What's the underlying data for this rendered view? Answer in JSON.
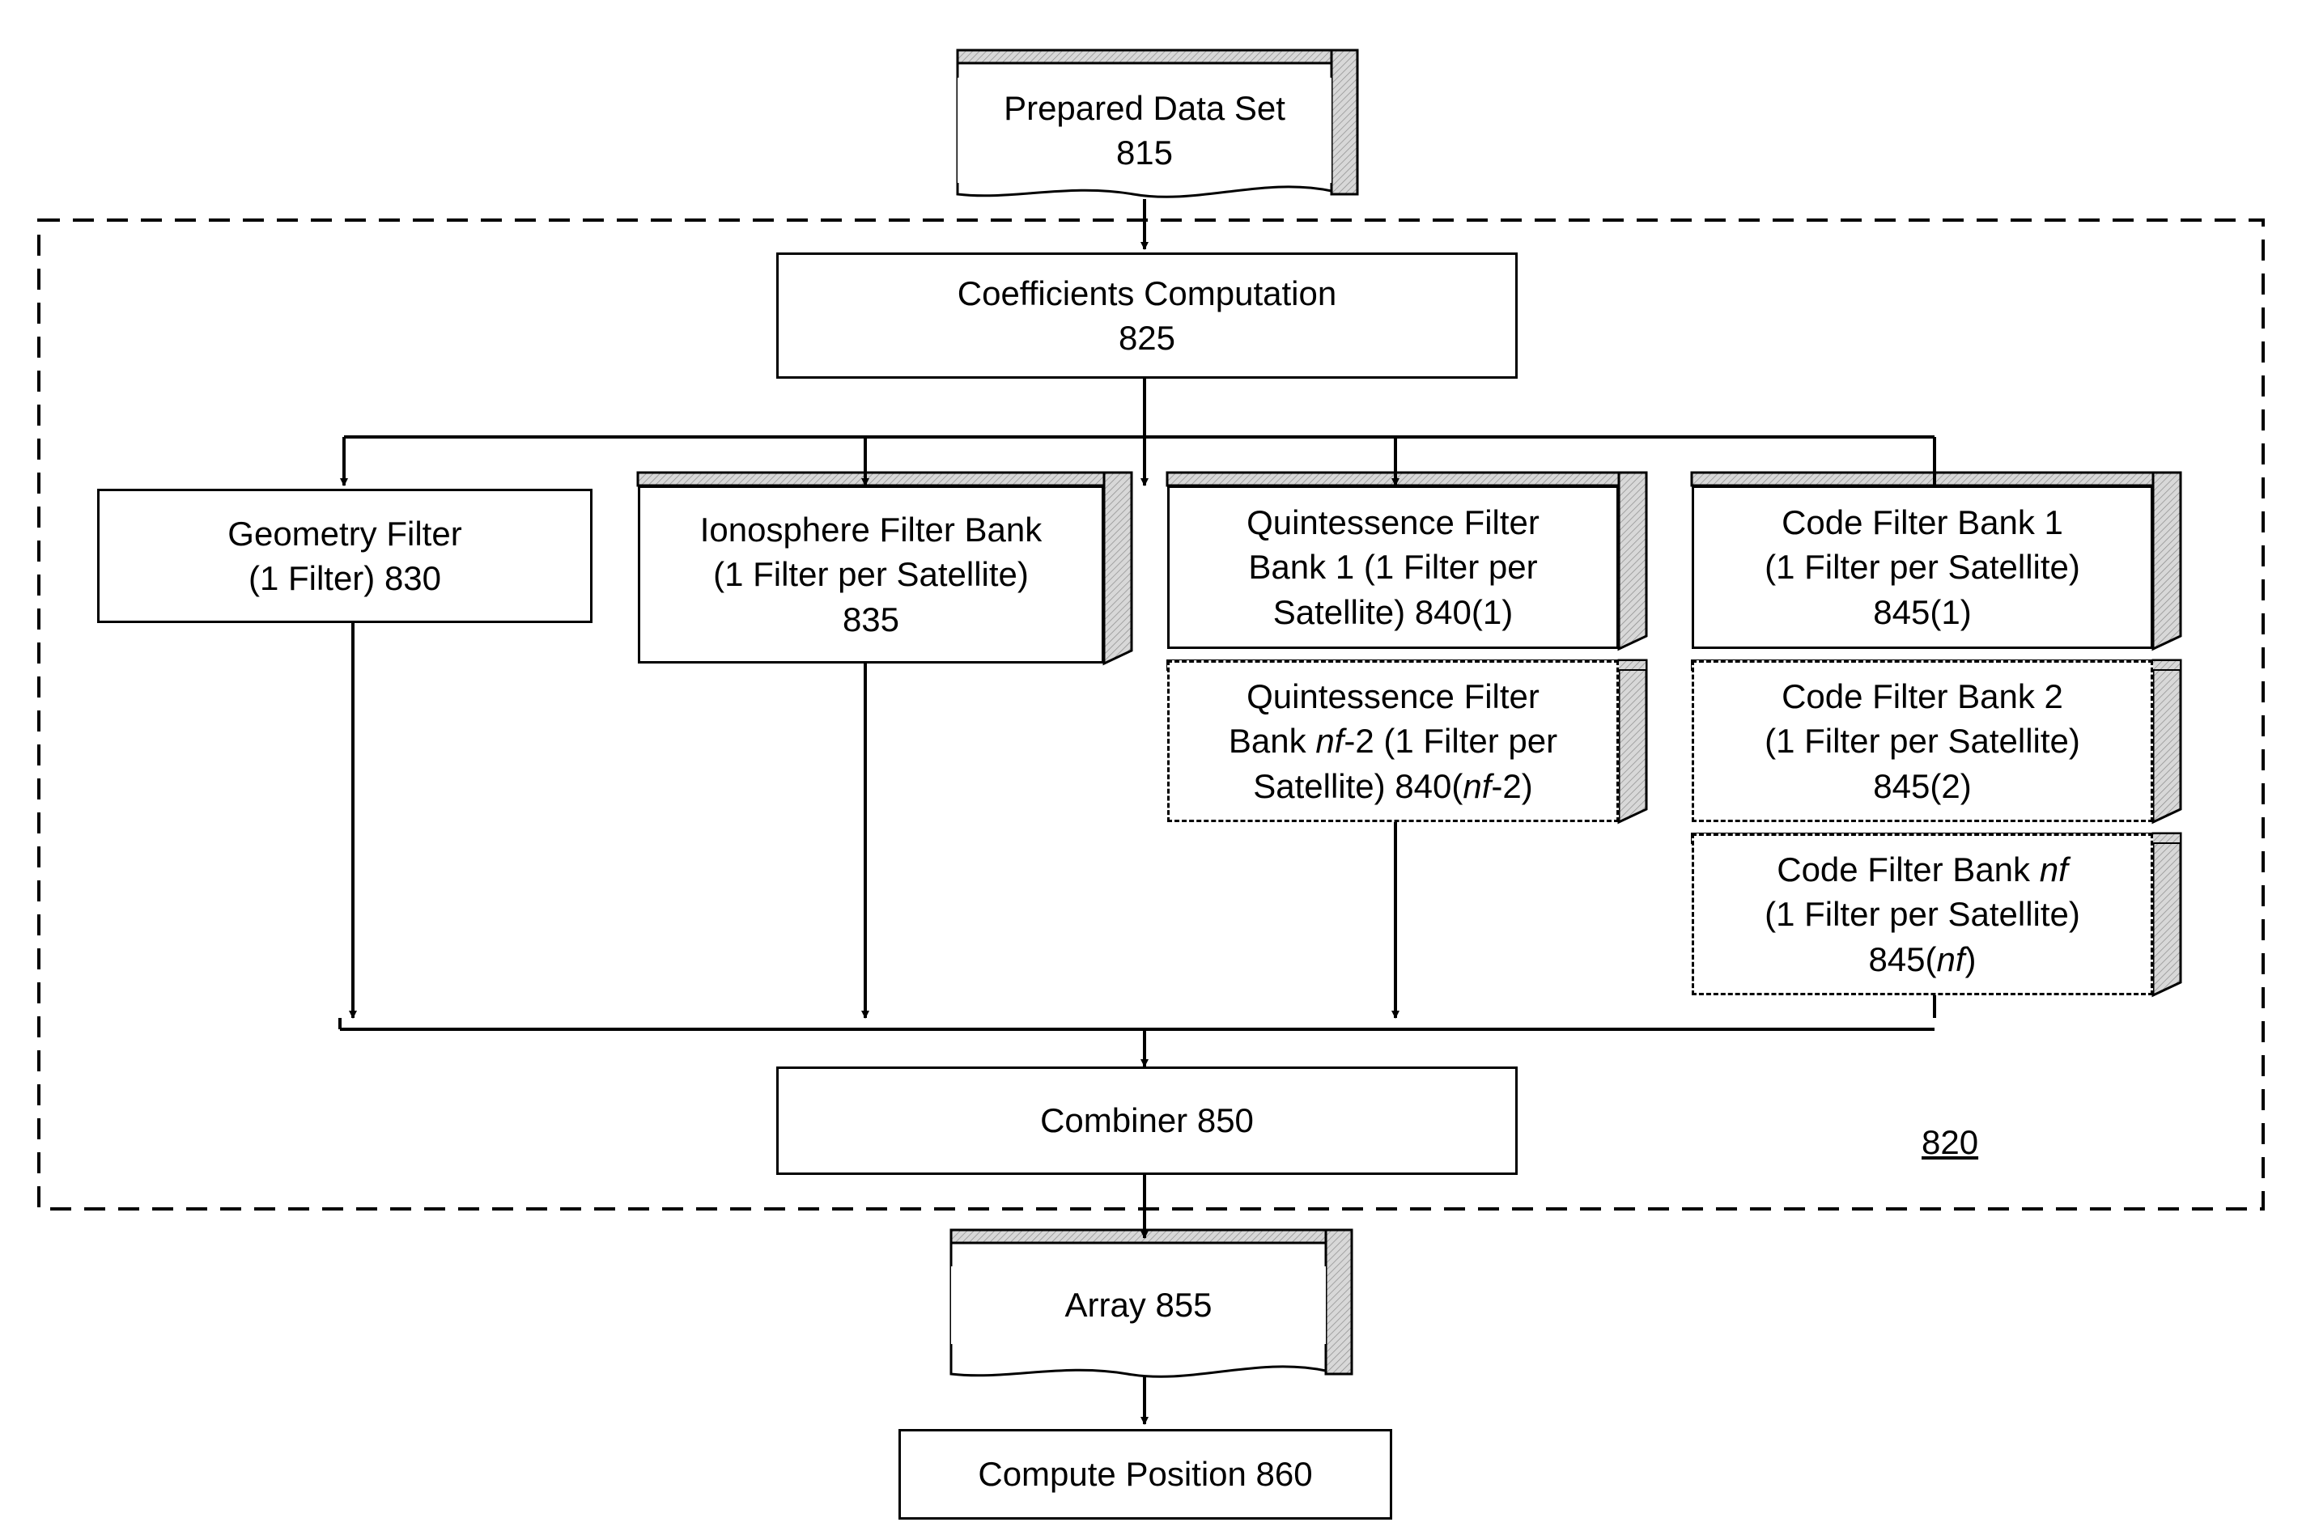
{
  "diagram": {
    "title_region_label": "820",
    "nodes": {
      "prepared_data_set": {
        "line1": "Prepared Data Set",
        "line2": "815"
      },
      "coefficients_computation": {
        "line1": "Coefficients Computation",
        "line2": "825"
      },
      "geometry_filter": {
        "line1": "Geometry Filter",
        "line2": "(1 Filter) 830"
      },
      "ionosphere_filter_bank": {
        "line1": "Ionosphere Filter Bank",
        "line2": "(1 Filter per Satellite)",
        "line3": "835"
      },
      "quintessence_bank_1": {
        "line1": "Quintessence Filter",
        "line2": "Bank 1 (1 Filter per",
        "line3": "Satellite) 840(1)"
      },
      "quintessence_bank_nf2": {
        "line1": "Quintessence Filter",
        "line2_pre": "Bank ",
        "line2_ital": "nf",
        "line2_post": "-2 (1 Filter per",
        "line3_pre": "Satellite) 840(",
        "line3_ital": "nf",
        "line3_post": "-2)"
      },
      "code_filter_bank_1": {
        "line1": "Code Filter Bank 1",
        "line2": "(1 Filter per Satellite)",
        "line3": "845(1)"
      },
      "code_filter_bank_2": {
        "line1": "Code Filter Bank 2",
        "line2": "(1 Filter per Satellite)",
        "line3": "845(2)"
      },
      "code_filter_bank_nf": {
        "line1_pre": "Code Filter Bank ",
        "line1_ital": "nf",
        "line2": "(1 Filter per Satellite)",
        "line3_pre": "845(",
        "line3_ital": "nf",
        "line3_post": ")"
      },
      "combiner": {
        "line1": "Combiner 850"
      },
      "array": {
        "line1": "Array 855"
      },
      "compute_position": {
        "line1": "Compute Position 860"
      }
    }
  }
}
